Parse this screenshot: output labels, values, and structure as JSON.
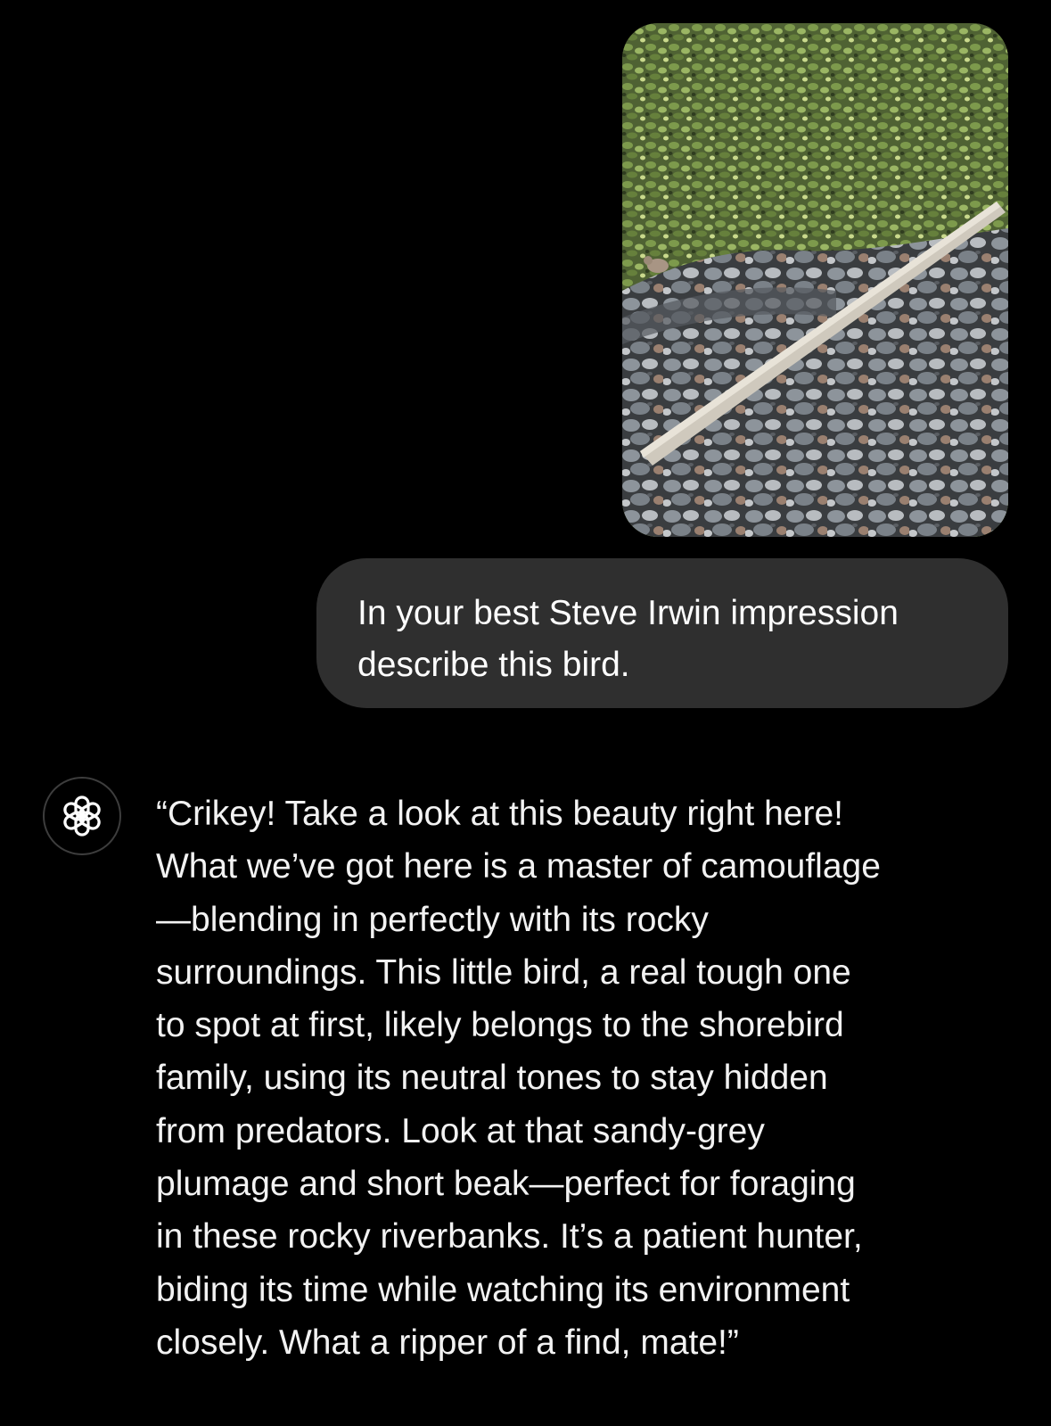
{
  "conversation": {
    "user_message": {
      "image": {
        "icon": "photo-of-bird-on-rocky-riverbank"
      },
      "text": "In your best Steve Irwin impression\ndescribe this bird."
    },
    "assistant_message": {
      "avatar_icon": "openai-logo-icon",
      "text": "“Crikey! Take a look at this beauty right here!\nWhat we’ve got here is a master of camouflage\n—blending in perfectly with its rocky\nsurroundings. This little bird, a real tough one\nto spot at first, likely belongs to the shorebird\nfamily, using its neutral tones to stay hidden\nfrom predators. Look at that sandy-grey\nplumage and short beak—perfect for foraging\nin these rocky riverbanks. It’s a patient hunter,\nbiding its time while watching its environment\nclosely. What a ripper of a find, mate!”"
    }
  },
  "colors": {
    "background": "#000000",
    "user_bubble": "#2f2f2f",
    "text": "#ffffff",
    "avatar_border": "#3d3d3d"
  }
}
